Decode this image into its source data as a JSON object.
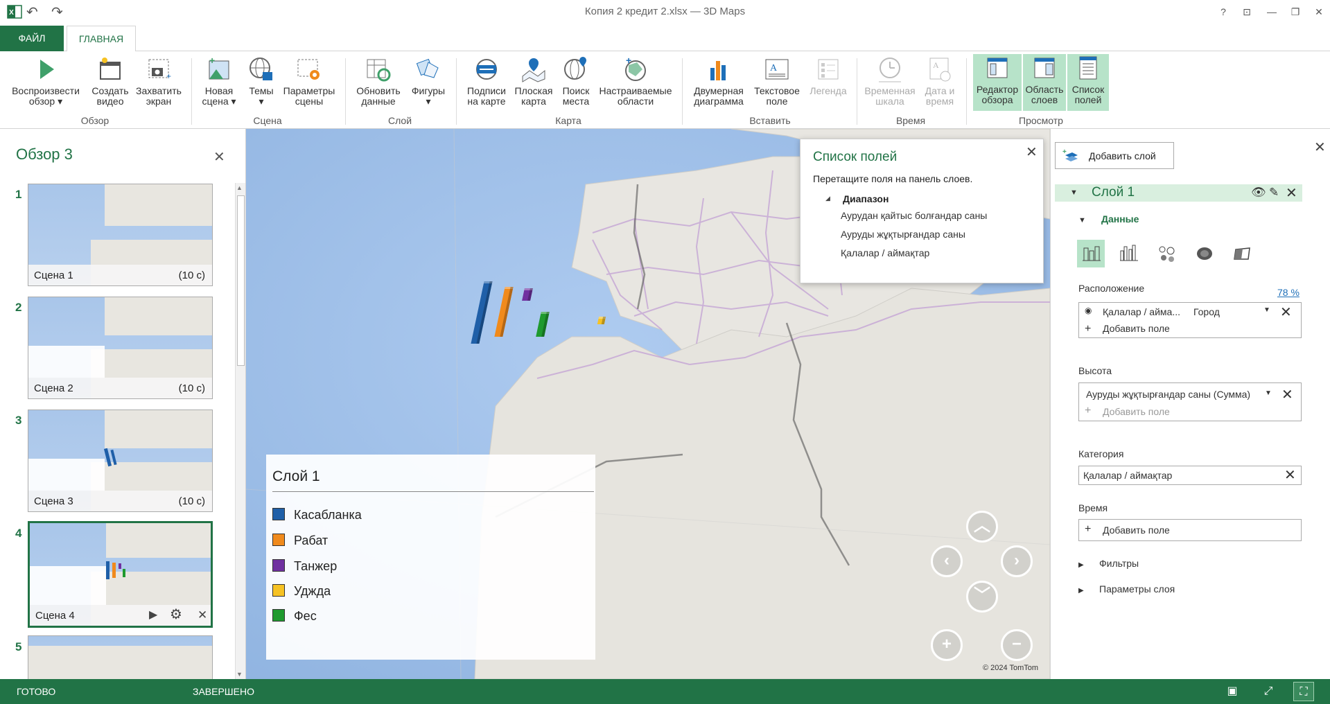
{
  "titlebar": {
    "title": "Копия 2 кредит  2.xlsx — 3D Maps",
    "help": "?",
    "restore_ribbon": "⊡",
    "minimize": "—",
    "maximize": "❐",
    "close": "✕"
  },
  "tabs": {
    "file": "ФАЙЛ",
    "home": "ГЛАВНАЯ"
  },
  "ribbon": {
    "play_tour": "Воспроизвести обзор",
    "create_video": "Создать видео",
    "capture_screen": "Захватить экран",
    "group_tour": "Обзор",
    "new_scene": "Новая сцена",
    "themes": "Темы",
    "scene_options": "Параметры сцены",
    "group_scene": "Сцена",
    "refresh_data": "Обновить данные",
    "shapes": "Фигуры",
    "group_layer": "Слой",
    "map_labels": "Подписи на карте",
    "flat_map": "Плоская карта",
    "find_location": "Поиск места",
    "custom_regions": "Настраиваемые области",
    "group_map": "Карта",
    "chart_2d": "Двумерная диаграмма",
    "text_box": "Текстовое поле",
    "legend": "Легенда",
    "group_insert": "Вставить",
    "timeline": "Временная шкала",
    "date_time": "Дата и время",
    "group_time": "Время",
    "tour_editor": "Редактор обзора",
    "layer_pane": "Область слоев",
    "field_list": "Список полей",
    "group_view": "Просмотр"
  },
  "tour": {
    "title": "Обзор 3",
    "close": "✕",
    "scenes": [
      {
        "num": "1",
        "name": "Сцена 1",
        "duration": "(10 с)"
      },
      {
        "num": "2",
        "name": "Сцена 2",
        "duration": "(10 с)"
      },
      {
        "num": "3",
        "name": "Сцена 3",
        "duration": "(10 с)"
      },
      {
        "num": "4",
        "name": "Сцена 4",
        "duration": ""
      },
      {
        "num": "5",
        "name": "",
        "duration": ""
      }
    ],
    "selected_scene": "4"
  },
  "legend": {
    "title": "Слой 1",
    "items": [
      {
        "label": "Касабланка",
        "color": "#1f5fa8"
      },
      {
        "label": "Рабат",
        "color": "#f08a1c"
      },
      {
        "label": "Танжер",
        "color": "#7030a0"
      },
      {
        "label": "Уджда",
        "color": "#f6c223"
      },
      {
        "label": "Фес",
        "color": "#1f9a2e"
      }
    ]
  },
  "bars": [
    {
      "city": "Касабланка",
      "value": 100
    },
    {
      "city": "Рабат",
      "value": 80
    },
    {
      "city": "Танжер",
      "value": 20
    },
    {
      "city": "Уджда",
      "value": 12
    },
    {
      "city": "Фес",
      "value": 40
    }
  ],
  "map": {
    "copyright": "© 2024 TomTom"
  },
  "fieldlist": {
    "title": "Список полей",
    "hint": "Перетащите поля на панель слоев.",
    "range": "Диапазон",
    "fields": [
      "Аурудан қайтыс болғандар саны",
      "Ауруды жұқтырғандар саны",
      "Қалалар / аймақтар"
    ]
  },
  "layerpane": {
    "add_layer": "Добавить слой",
    "layer_name": "Слой 1",
    "data_section": "Данные",
    "location_label": "Расположение",
    "location_pct": "78 %",
    "location_field": "Қалалар / айма...",
    "location_type": "Город",
    "add_field": "Добавить поле",
    "height_label": "Высота",
    "height_field": "Ауруды жұқтырғандар саны (Сумма)",
    "category_label": "Категория",
    "category_field": "Қалалар / аймақтар",
    "time_label": "Время",
    "filters": "Фильтры",
    "layer_options": "Параметры слоя"
  },
  "status": {
    "ready": "ГОТОВО",
    "complete": "ЗАВЕРШЕНО"
  },
  "colors": {
    "accent": "#217346",
    "active_ribbon": "#b7e3c9"
  }
}
